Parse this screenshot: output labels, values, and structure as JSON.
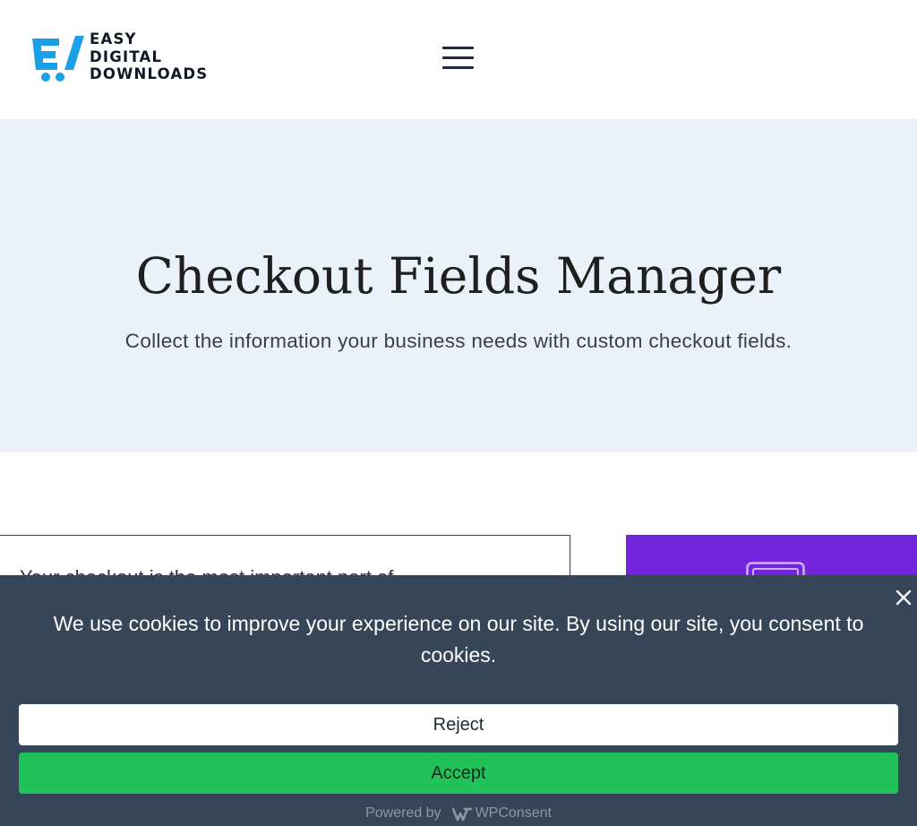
{
  "header": {
    "logo": {
      "lines": [
        "EASY",
        "DIGITAL",
        "DOWNLOADS"
      ],
      "icon": "cart-icon",
      "icon_color": "#1aa0e6"
    },
    "menu_icon": "hamburger-menu-icon"
  },
  "hero": {
    "title": "Checkout Fields Manager",
    "subtitle": "Collect the information your business needs with custom checkout fields.",
    "background": "#ebf1f8"
  },
  "content": {
    "card_text": "Your checkout is the most important part of",
    "promo_color": "#7424db",
    "promo_icon": "browser-window-icon"
  },
  "cookie_banner": {
    "message": "We use cookies to improve your experience on our site. By using our site, you consent to cookies.",
    "reject_label": "Reject",
    "accept_label": "Accept",
    "powered_by_label": "Powered by",
    "brand_name": "WPConsent",
    "close_icon": "close-icon",
    "background": "#364557",
    "accept_color": "#22c25a"
  }
}
